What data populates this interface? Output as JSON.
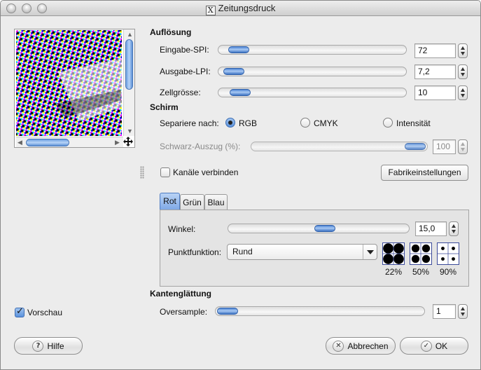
{
  "window": {
    "title": "Zeitungsdruck",
    "title_icon": "X"
  },
  "resolution": {
    "heading": "Auflösung",
    "input_spi": {
      "label": "Eingabe-SPI:",
      "value": "72",
      "slider_fraction": 0.05
    },
    "output_lpi": {
      "label": "Ausgabe-LPI:",
      "value": "7,2",
      "slider_fraction": 0.02
    },
    "cell_size": {
      "label": "Zellgrösse:",
      "value": "10",
      "slider_fraction": 0.06
    }
  },
  "screen": {
    "heading": "Schirm",
    "separate_label": "Separiere nach:",
    "options": [
      {
        "label": "RGB",
        "selected": true
      },
      {
        "label": "CMYK",
        "selected": false
      },
      {
        "label": "Intensität",
        "selected": false
      }
    ],
    "black_pullout": {
      "label": "Schwarz-Auszug (%):",
      "value": "100",
      "slider_fraction": 1.0,
      "enabled": false
    },
    "link_channels": {
      "label": "Kanäle verbinden",
      "checked": false
    },
    "factory_defaults_label": "Fabrikeinstellungen"
  },
  "tabs": [
    {
      "label": "Rot",
      "active": true
    },
    {
      "label": "Grün",
      "active": false
    },
    {
      "label": "Blau",
      "active": false
    }
  ],
  "channel": {
    "angle": {
      "label": "Winkel:",
      "value": "15,0",
      "slider_fraction": 0.54
    },
    "spot_function": {
      "label": "Punktfunktion:",
      "value": "Rund"
    },
    "swatches": [
      {
        "label": "22%"
      },
      {
        "label": "50%"
      },
      {
        "label": "90%"
      }
    ]
  },
  "antialias": {
    "heading": "Kantenglättung",
    "oversample": {
      "label": "Oversample:",
      "value": "1",
      "slider_fraction": 0.0
    }
  },
  "preview": {
    "label": "Vorschau",
    "checked": true
  },
  "buttons": {
    "help": "Hilfe",
    "cancel": "Abbrechen",
    "ok": "OK"
  },
  "icons": {
    "help": "question-icon",
    "cancel": "cancel-x-icon",
    "ok": "checkmark-icon",
    "move": "move-cross-icon"
  },
  "colors": {
    "accent": "#5b92dc",
    "window_bg": "#ececec"
  }
}
